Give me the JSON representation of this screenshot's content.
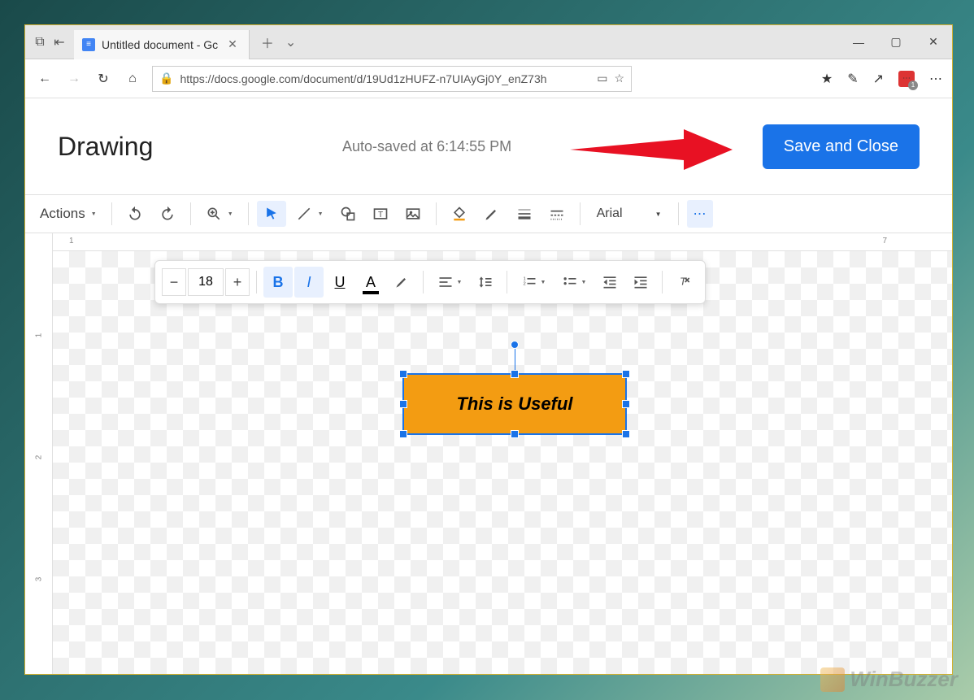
{
  "browser": {
    "tab_title": "Untitled document - Gc",
    "url": "https://docs.google.com/document/d/19Ud1zHUFZ-n7UIAyGj0Y_enZ73h"
  },
  "dialog": {
    "title": "Drawing",
    "autosave": "Auto-saved at 6:14:55 PM",
    "save_button": "Save and Close"
  },
  "toolbar": {
    "actions": "Actions",
    "font": "Arial",
    "font_size": "18"
  },
  "textbox": {
    "text": "This is Useful",
    "fill_color": "#f39c12"
  },
  "ruler": {
    "h_ticks": [
      "1",
      "7"
    ],
    "v_ticks": [
      "1",
      "2",
      "3"
    ]
  },
  "watermark": "WinBuzzer"
}
